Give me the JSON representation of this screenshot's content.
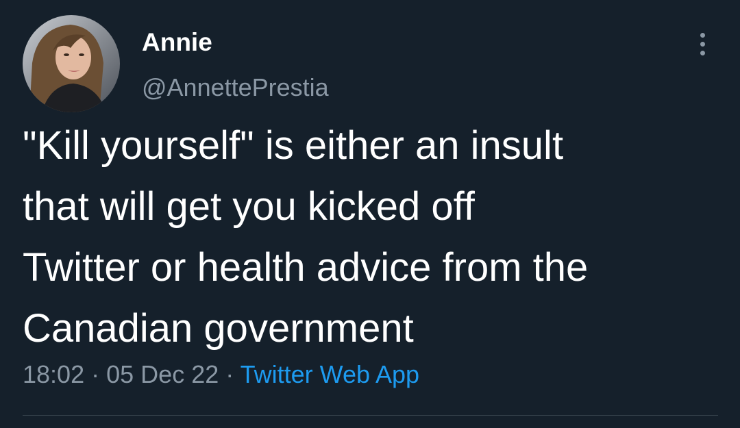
{
  "tweet": {
    "author": {
      "display_name": "Annie",
      "handle": "@AnnettePrestia"
    },
    "text_lines": [
      "\"Kill yourself\" is either an insult",
      "that will get you kicked off",
      "Twitter or health advice from the",
      "Canadian government"
    ],
    "time": "18:02",
    "date": "05 Dec 22",
    "separator": "·",
    "source": "Twitter Web App"
  },
  "icons": {
    "more": "more-vertical-icon"
  },
  "colors": {
    "background": "#15202b",
    "text_primary": "#ffffff",
    "text_secondary": "#8b98a5",
    "link": "#1d9bf0",
    "divider": "#38444d"
  }
}
